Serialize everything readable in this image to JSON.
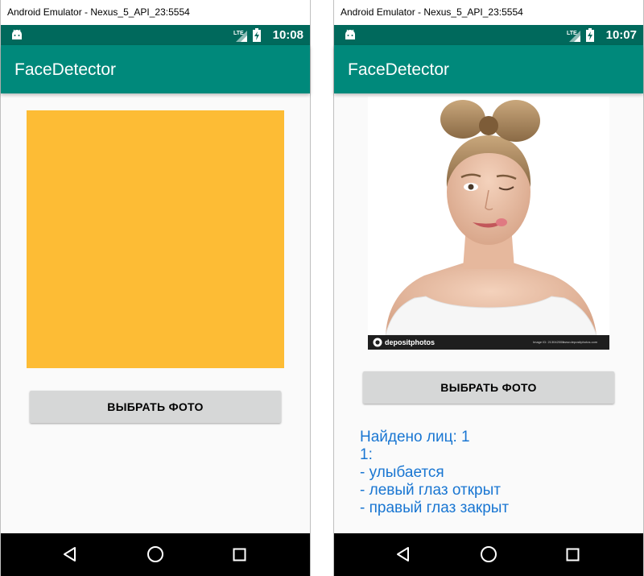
{
  "windows": [
    {
      "window_title": "Android Emulator - Nexus_5_API_23:5554",
      "status_time": "10:08",
      "app_title": "FaceDetector",
      "button_label": "ВЫБРАТЬ ФОТО",
      "placeholder_color": "#fdbc35"
    },
    {
      "window_title": "Android Emulator - Nexus_5_API_23:5554",
      "status_time": "10:07",
      "app_title": "FaceDetector",
      "button_label": "ВЫБРАТЬ ФОТО",
      "watermark": {
        "brand": "depositphotos",
        "image_id": "Image ID: 213042000",
        "site": "www.depositphotos.com"
      },
      "results": [
        "Найдено лиц: 1",
        "1:",
        "- улыбается",
        "- левый глаз открыт",
        "- правый глаз закрыт"
      ]
    }
  ],
  "colors": {
    "status_bar": "#00695c",
    "app_bar": "#00897b",
    "background": "#fafafa",
    "button": "#d6d7d7",
    "result_text": "#1976d2",
    "nav_bar": "#000000"
  }
}
